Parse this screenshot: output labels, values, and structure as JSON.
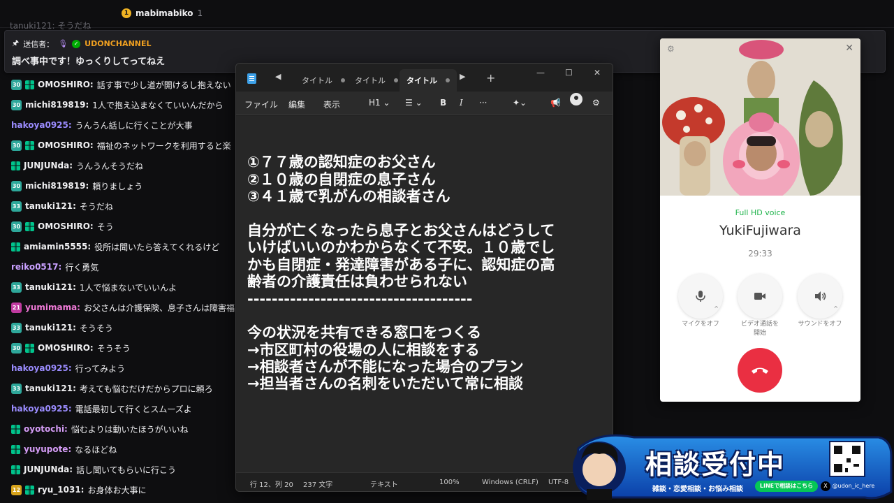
{
  "topbar": {
    "user": "mabimabiko",
    "count": "1",
    "ghost_text": "tanuki121:  そうだね"
  },
  "pinned": {
    "sender_label": "送信者：",
    "channel": "UDONCHANNEL",
    "message": "調べ事中です！ゆっくりしてってねえ"
  },
  "chat": {
    "messages": [
      {
        "badge": "30",
        "gift": true,
        "user": "OMOSHIRO:",
        "text": "話す事で少し道が開けるし抱えない",
        "color": "#efeff1",
        "badge_color": "#2ea79a"
      },
      {
        "badge": "30",
        "gift": false,
        "user": "michi819819:",
        "text": "1人で抱え込まなくていいんだから",
        "color": "#efeff1",
        "badge_color": "#2ea79a"
      },
      {
        "badge": "",
        "gift": false,
        "user": "hakoya0925:",
        "text": "うんうん話しに行くことが大事",
        "color": "#9b8cff",
        "badge_color": ""
      },
      {
        "badge": "30",
        "gift": true,
        "user": "OMOSHIRO:",
        "text": "福祉のネットワークを利用すると楽",
        "color": "#efeff1",
        "badge_color": "#2ea79a"
      },
      {
        "badge": "",
        "gift": true,
        "user": "JUNJUNda:",
        "text": "うんうんそうだね",
        "color": "#efeff1",
        "badge_color": ""
      },
      {
        "badge": "30",
        "gift": false,
        "user": "michi819819:",
        "text": "頼りましょう",
        "color": "#efeff1",
        "badge_color": "#2ea79a"
      },
      {
        "badge": "33",
        "gift": false,
        "user": "tanuki121:",
        "text": "そうだね",
        "color": "#efeff1",
        "badge_color": "#2ea79a"
      },
      {
        "badge": "30",
        "gift": true,
        "user": "OMOSHIRO:",
        "text": "そう",
        "color": "#efeff1",
        "badge_color": "#2ea79a"
      },
      {
        "badge": "",
        "gift": true,
        "user": "amiamin5555:",
        "text": "役所は聞いたら答えてくれるけど",
        "color": "#efeff1",
        "badge_color": ""
      },
      {
        "badge": "",
        "gift": false,
        "user": "reiko0517:",
        "text": "行く勇気",
        "color": "#c9a0ff",
        "badge_color": ""
      },
      {
        "badge": "33",
        "gift": false,
        "user": "tanuki121:",
        "text": "1人で悩まないでいいんよ",
        "color": "#efeff1",
        "badge_color": "#2ea79a"
      },
      {
        "badge": "21",
        "gift": false,
        "user": "yumimama:",
        "text": "お父さんは介護保険、息子さんは障害福",
        "color": "#f07ad8",
        "badge_color": "#c03aa0"
      },
      {
        "badge": "33",
        "gift": false,
        "user": "tanuki121:",
        "text": "そうそう",
        "color": "#efeff1",
        "badge_color": "#2ea79a"
      },
      {
        "badge": "30",
        "gift": true,
        "user": "OMOSHIRO:",
        "text": "そうそう",
        "color": "#efeff1",
        "badge_color": "#2ea79a"
      },
      {
        "badge": "",
        "gift": false,
        "user": "hakoya0925:",
        "text": "行ってみよう",
        "color": "#9b8cff",
        "badge_color": ""
      },
      {
        "badge": "33",
        "gift": false,
        "user": "tanuki121:",
        "text": "考えても悩むだけだからプロに頼ろ",
        "color": "#efeff1",
        "badge_color": "#2ea79a"
      },
      {
        "badge": "",
        "gift": false,
        "user": "hakoya0925:",
        "text": "電話最初して行くとスムーズよ",
        "color": "#9b8cff",
        "badge_color": ""
      },
      {
        "badge": "",
        "gift": true,
        "user": "oyotochi:",
        "text": "悩むよりは動いたほうがいいね",
        "color": "#d49cf5",
        "badge_color": ""
      },
      {
        "badge": "",
        "gift": true,
        "user": "yuyupote:",
        "text": "なるほどね",
        "color": "#d49cf5",
        "badge_color": ""
      },
      {
        "badge": "",
        "gift": true,
        "user": "JUNJUNda:",
        "text": "話し聞いてもらいに行こう",
        "color": "#efeff1",
        "badge_color": ""
      },
      {
        "badge": "12",
        "gift": true,
        "user": "ryu_1031:",
        "text": "お身体お大事に",
        "color": "#efeff1",
        "badge_color": "#d6a21a"
      }
    ]
  },
  "notepad": {
    "tabs": [
      "タイトル",
      "タイトル",
      "タイトル"
    ],
    "active_tab": 2,
    "menu": {
      "file": "ファイル",
      "edit": "編集",
      "view": "表示"
    },
    "toolbar": {
      "heading": "H1",
      "bold": "B",
      "italic": "I",
      "more": "···"
    },
    "lines": [
      "",
      "①７７歳の認知症のお父さん",
      "②１０歳の自閉症の息子さん",
      "③４１歳で乳がんの相談者さん",
      "",
      "自分が亡くなったら息子とお父さんはどうして",
      "いけばいいのかわからなくて不安。１０歳でし",
      "かも自閉症・発達障害がある子に、認知症の高",
      "齢者の介護責任は負わせられない",
      "-------------------------------------",
      "",
      "今の状況を共有できる窓口をつくる",
      "→市区町村の役場の人に相談をする",
      "→相談者さんが不能になった場合のプラン",
      "→担当者さんの名刺をいただいて常に相談"
    ],
    "status": {
      "position": "行 12、列 20",
      "chars": "237 文字",
      "format": "テキスト",
      "zoom": "100%",
      "eol": "Windows (CRLF)",
      "encoding": "UTF-8"
    }
  },
  "call": {
    "voice_label": "Full HD voice",
    "name": "YukiFujiwara",
    "duration": "29:33",
    "mute_label": "マイクをオフ",
    "video_label_1": "ビデオ通話を",
    "video_label_2": "開始",
    "sound_label": "サウンドをオフ"
  },
  "banner": {
    "title": "相談受付中",
    "subtitle": "雑談・恋愛相談・お悩み相談",
    "line_text": "LINEで相談はこちら",
    "handle": "@udon_ic_here"
  }
}
